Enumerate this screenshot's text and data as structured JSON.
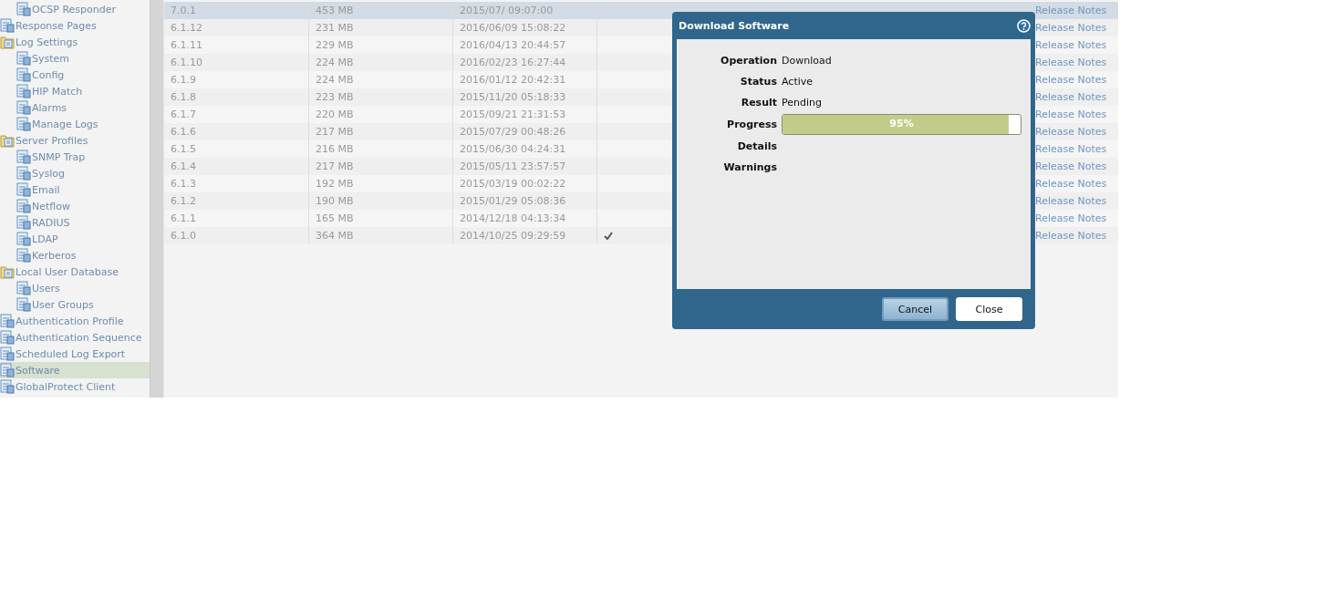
{
  "sidebar": {
    "items": [
      {
        "children": [
          {
            "label": "OCSP Responder",
            "selected": false
          }
        ]
      },
      {
        "label": "Response Pages",
        "selected": false
      },
      {
        "label": "Log Settings",
        "selected": false,
        "children": [
          {
            "label": "System",
            "selected": false
          },
          {
            "label": "Config",
            "selected": false
          },
          {
            "label": "HIP Match",
            "selected": false
          },
          {
            "label": "Alarms",
            "selected": false
          },
          {
            "label": "Manage Logs",
            "selected": false
          }
        ]
      },
      {
        "label": "Server Profiles",
        "selected": false,
        "children": [
          {
            "label": "SNMP Trap",
            "selected": false
          },
          {
            "label": "Syslog",
            "selected": false
          },
          {
            "label": "Email",
            "selected": false
          },
          {
            "label": "Netflow",
            "selected": false
          },
          {
            "label": "RADIUS",
            "selected": false
          },
          {
            "label": "LDAP",
            "selected": false
          },
          {
            "label": "Kerberos",
            "selected": false
          }
        ]
      },
      {
        "label": "Local User Database",
        "selected": false,
        "children": [
          {
            "label": "Users",
            "selected": false
          },
          {
            "label": "User Groups",
            "selected": false
          }
        ]
      },
      {
        "label": "Authentication Profile",
        "selected": false
      },
      {
        "label": "Authentication Sequence",
        "selected": false
      },
      {
        "label": "Scheduled Log Export",
        "selected": false
      },
      {
        "label": "Software",
        "selected": true
      },
      {
        "label": "GlobalProtect Client",
        "selected": false
      }
    ]
  },
  "table": {
    "rows": [
      {
        "version": "7.0.1",
        "size": "453 MB",
        "date": "2015/07/ 09:07:00",
        "current": false,
        "notes": "Release Notes",
        "selected": true
      },
      {
        "version": "6.1.12",
        "size": "231 MB",
        "date": "2016/06/09 15:08:22",
        "current": false,
        "notes": "Release Notes",
        "selected": false
      },
      {
        "version": "6.1.11",
        "size": "229 MB",
        "date": "2016/04/13 20:44:57",
        "current": false,
        "notes": "Release Notes",
        "selected": false
      },
      {
        "version": "6.1.10",
        "size": "224 MB",
        "date": "2016/02/23 16:27:44",
        "current": false,
        "notes": "Release Notes",
        "selected": false
      },
      {
        "version": "6.1.9",
        "size": "224 MB",
        "date": "2016/01/12 20:42:31",
        "current": false,
        "notes": "Release Notes",
        "selected": false
      },
      {
        "version": "6.1.8",
        "size": "223 MB",
        "date": "2015/11/20 05:18:33",
        "current": false,
        "notes": "Release Notes",
        "selected": false
      },
      {
        "version": "6.1.7",
        "size": "220 MB",
        "date": "2015/09/21 21:31:53",
        "current": false,
        "notes": "Release Notes",
        "selected": false
      },
      {
        "version": "6.1.6",
        "size": "217 MB",
        "date": "2015/07/29 00:48:26",
        "current": false,
        "notes": "Release Notes",
        "selected": false
      },
      {
        "version": "6.1.5",
        "size": "216 MB",
        "date": "2015/06/30 04:24:31",
        "current": false,
        "notes": "Release Notes",
        "selected": false
      },
      {
        "version": "6.1.4",
        "size": "217 MB",
        "date": "2015/05/11 23:57:57",
        "current": false,
        "notes": "Release Notes",
        "selected": false
      },
      {
        "version": "6.1.3",
        "size": "192 MB",
        "date": "2015/03/19 00:02:22",
        "current": false,
        "notes": "Release Notes",
        "selected": false
      },
      {
        "version": "6.1.2",
        "size": "190 MB",
        "date": "2015/01/29 05:08:36",
        "current": false,
        "notes": "Release Notes",
        "selected": false
      },
      {
        "version": "6.1.1",
        "size": "165 MB",
        "date": "2014/12/18 04:13:34",
        "current": false,
        "notes": "Release Notes",
        "selected": false
      },
      {
        "version": "6.1.0",
        "size": "364 MB",
        "date": "2014/10/25 09:29:59",
        "current": true,
        "notes": "Release Notes",
        "selected": false
      }
    ]
  },
  "dialog": {
    "title": "Download Software",
    "fields": [
      {
        "label": "Operation",
        "kind": "text",
        "value": "Download"
      },
      {
        "label": "Status",
        "kind": "text",
        "value": "Active"
      },
      {
        "label": "Result",
        "kind": "text",
        "value": "Pending"
      },
      {
        "label": "Progress",
        "kind": "progress",
        "level": 0.95,
        "value": "95%"
      },
      {
        "label": "Details",
        "kind": "text"
      },
      {
        "label": "Warnings",
        "kind": "text"
      }
    ],
    "buttons": [
      {
        "label": "Cancel",
        "kind": "primary"
      },
      {
        "label": "Close",
        "kind": "plain"
      }
    ]
  }
}
